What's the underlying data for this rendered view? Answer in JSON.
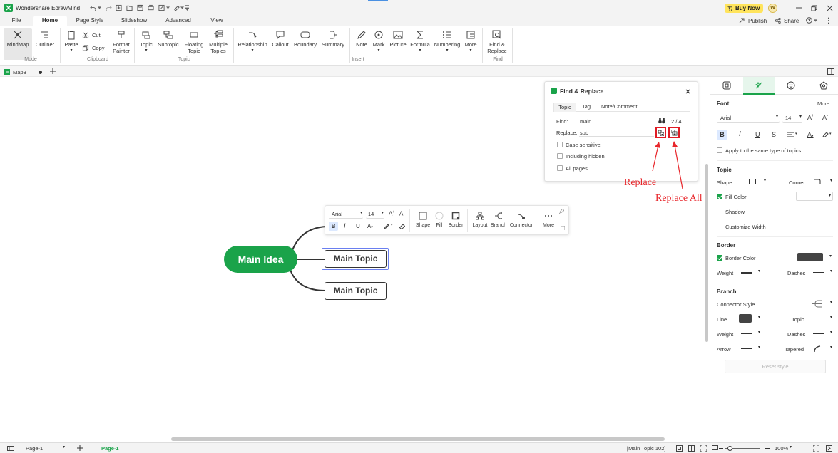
{
  "app": {
    "title": "Wondershare EdrawMind",
    "buy_now": "Buy Now",
    "user_initial": "W",
    "publish": "Publish",
    "share": "Share"
  },
  "menu_tabs": [
    "File",
    "Home",
    "Page Style",
    "Slideshow",
    "Advanced",
    "View"
  ],
  "ribbon": {
    "mode": {
      "mindmap": "MindMap",
      "outliner": "Outliner",
      "group": "Mode"
    },
    "clipboard": {
      "paste": "Paste",
      "cut": "Cut",
      "copy": "Copy",
      "format_painter": [
        "Format",
        "Painter"
      ],
      "group": "Clipboard"
    },
    "topic": {
      "topic": "Topic",
      "subtopic": "Subtopic",
      "floating": [
        "Floating",
        "Topic"
      ],
      "multiple": [
        "Multiple",
        "Topics"
      ],
      "group": "Topic"
    },
    "insert": {
      "relationship": "Relationship",
      "callout": "Callout",
      "boundary": "Boundary",
      "summary": "Summary",
      "note": "Note",
      "mark": "Mark",
      "picture": "Picture",
      "formula": "Formula",
      "numbering": "Numbering",
      "more": "More",
      "group": "Insert"
    },
    "find": {
      "label": [
        "Find &",
        "Replace"
      ],
      "group": "Find"
    }
  },
  "doc_tab": {
    "name": "Map3"
  },
  "find_replace": {
    "title": "Find & Replace",
    "tabs": [
      "Topic",
      "Tag",
      "Note/Comment"
    ],
    "find_label": "Find:",
    "find_value": "main",
    "count": "2 / 4",
    "replace_label": "Replace:",
    "replace_value": "sub",
    "options": [
      "Case sensitive",
      "Including hidden",
      "All pages"
    ]
  },
  "annotations": {
    "replace": "Replace",
    "replace_all": "Replace All"
  },
  "floating_toolbar": {
    "font": "Arial",
    "size": "14",
    "buttons": [
      "Shape",
      "Fill",
      "Border",
      "Layout",
      "Branch",
      "Connector",
      "More"
    ]
  },
  "mindmap": {
    "main_idea": "Main Idea",
    "topics": [
      "Main Topic",
      "Main Topic"
    ]
  },
  "right_panel": {
    "font": {
      "title": "Font",
      "more": "More",
      "family": "Arial",
      "size": "14",
      "apply_same": "Apply to the same type of topics"
    },
    "topic": {
      "title": "Topic",
      "shape": "Shape",
      "corner": "Corner",
      "fill_color": "Fill Color",
      "shadow": "Shadow",
      "custom_width": "Customize Width"
    },
    "border": {
      "title": "Border",
      "border_color": "Border Color",
      "weight": "Weight",
      "dashes": "Dashes"
    },
    "branch": {
      "title": "Branch",
      "connector_style": "Connector Style",
      "line": "Line",
      "topic": "Topic",
      "weight": "Weight",
      "dashes": "Dashes",
      "arrow": "Arrow",
      "tapered": "Tapered"
    },
    "reset": "Reset style"
  },
  "status": {
    "page_select": "Page-1",
    "page_tab": "Page-1",
    "selection": "[Main Topic 102]",
    "zoom": "100%"
  },
  "colors": {
    "accent": "#1aa34a",
    "annotation": "#e8262b"
  }
}
